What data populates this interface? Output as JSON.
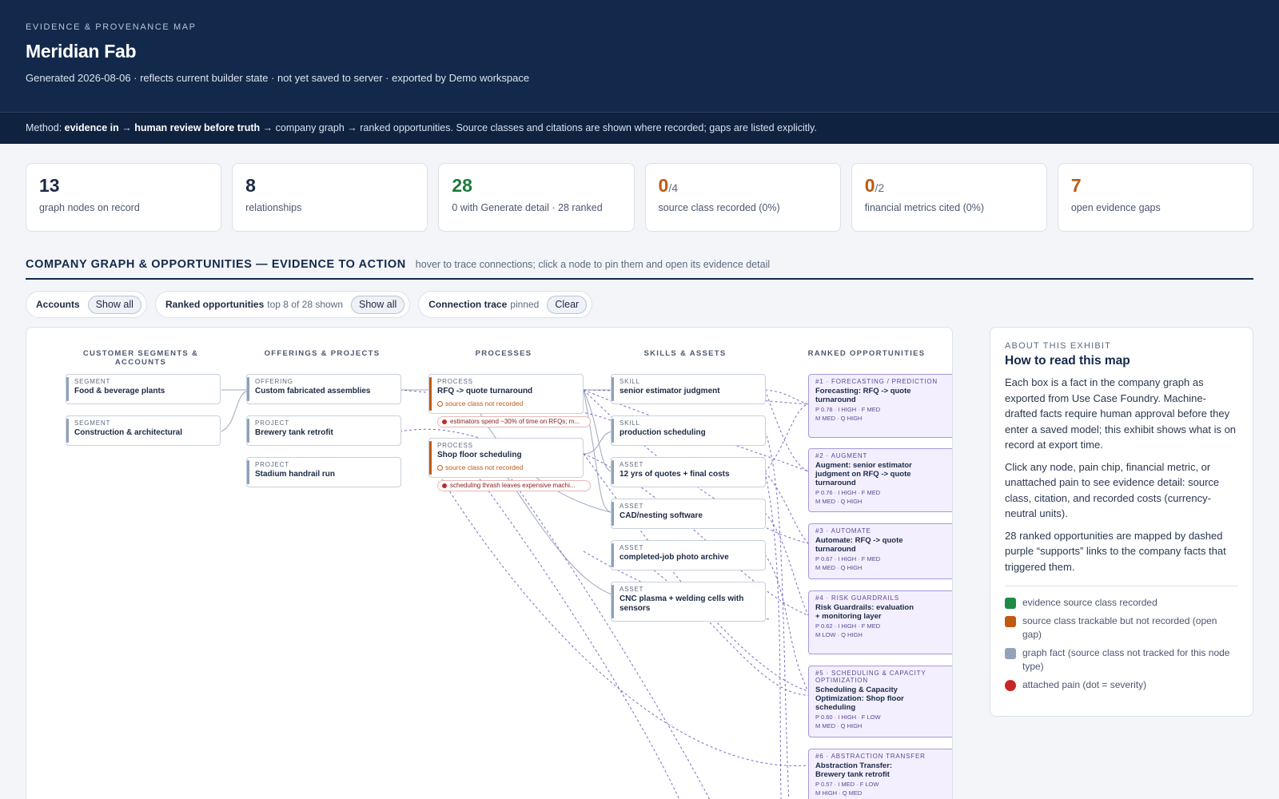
{
  "header": {
    "eyebrow": "EVIDENCE & PROVENANCE MAP",
    "title": "Meridian Fab",
    "subtitle": "Generated 2026-08-06 · reflects current builder state · not yet saved to server · exported by Demo workspace"
  },
  "method": {
    "prefix": "Method: ",
    "bold1": "evidence in",
    "arrow1": " → ",
    "bold2": "human review before truth",
    "rest": " → company graph → ranked opportunities. Source classes and citations are shown where recorded; gaps are listed explicitly."
  },
  "kpis": [
    {
      "value": "13",
      "denominator": "",
      "label": "graph nodes on record",
      "tone": "navy"
    },
    {
      "value": "8",
      "denominator": "",
      "label": "relationships",
      "tone": "navy"
    },
    {
      "value": "28",
      "denominator": "",
      "label": "0 with Generate detail · 28 ranked",
      "tone": "green"
    },
    {
      "value": "0",
      "denominator": "/4",
      "label": "source class recorded (0%)",
      "tone": "orange"
    },
    {
      "value": "0",
      "denominator": "/2",
      "label": "financial metrics cited (0%)",
      "tone": "orange"
    },
    {
      "value": "7",
      "denominator": "",
      "label": "open evidence gaps",
      "tone": "orange"
    }
  ],
  "section": {
    "title": "COMPANY GRAPH & OPPORTUNITIES — EVIDENCE TO ACTION",
    "hint": "hover to trace connections; click a node to pin them and open its evidence detail"
  },
  "controls": {
    "accounts": {
      "label": "Accounts",
      "meta": "",
      "button": "Show all"
    },
    "ranked": {
      "label": "Ranked opportunities",
      "meta": "top 8 of 28 shown",
      "button": "Show all"
    },
    "trace": {
      "label": "Connection trace",
      "meta": "pinned",
      "button": "Clear"
    }
  },
  "graph": {
    "columns": [
      "CUSTOMER SEGMENTS & ACCOUNTS",
      "OFFERINGS & PROJECTS",
      "PROCESSES",
      "SKILLS & ASSETS",
      "RANKED OPPORTUNITIES"
    ],
    "segments": [
      {
        "kind": "SEGMENT",
        "name": "Food & beverage plants"
      },
      {
        "kind": "SEGMENT",
        "name": "Construction & architectural"
      }
    ],
    "offerings": [
      {
        "kind": "OFFERING",
        "name": "Custom fabricated assemblies"
      },
      {
        "kind": "PROJECT",
        "name": "Brewery tank retrofit"
      },
      {
        "kind": "PROJECT",
        "name": "Stadium handrail run"
      }
    ],
    "processes": [
      {
        "kind": "PROCESS",
        "name": "RFQ -> quote turnaround",
        "gap": "source class not recorded",
        "pain": "estimators spend ~30% of time on RFQs; m..."
      },
      {
        "kind": "PROCESS",
        "name": "Shop floor scheduling",
        "gap": "source class not recorded",
        "pain": "scheduling thrash leaves expensive machi..."
      }
    ],
    "skills": [
      {
        "kind": "SKILL",
        "name": "senior estimator judgment"
      },
      {
        "kind": "SKILL",
        "name": "production scheduling"
      },
      {
        "kind": "ASSET",
        "name": "12 yrs of quotes + final costs"
      },
      {
        "kind": "ASSET",
        "name": "CAD/nesting software"
      },
      {
        "kind": "ASSET",
        "name": "completed-job photo archive"
      },
      {
        "kind": "ASSET",
        "name": "CNC plasma + welding cells with sensors"
      }
    ],
    "opportunities": [
      {
        "kind": "#1 · FORECASTING / PREDICTION",
        "name": "Forecasting: RFQ -> quote turnaround",
        "m1": "P 0.78 · I HIGH · F MED",
        "m2": "M MED · Q HIGH"
      },
      {
        "kind": "#2 · AUGMENT",
        "name": "Augment: senior estimator judgment on RFQ -> quote turnaround",
        "m1": "P 0.76 · I HIGH · F MED",
        "m2": "M MED · Q HIGH"
      },
      {
        "kind": "#3 · AUTOMATE",
        "name": "Automate: RFQ -> quote turnaround",
        "m1": "P 0.67 · I HIGH · F MED",
        "m2": "M MED · Q HIGH"
      },
      {
        "kind": "#4 · RISK GUARDRAILS",
        "name": "Risk Guardrails: evaluation + monitoring layer",
        "m1": "P 0.62 · I HIGH · F MED",
        "m2": "M LOW · Q HIGH"
      },
      {
        "kind": "#5 · SCHEDULING & CAPACITY OPTIMIZATION",
        "name": "Scheduling & Capacity Optimization: Shop floor scheduling",
        "m1": "P 0.60 · I HIGH · F LOW",
        "m2": "M MED · Q HIGH"
      },
      {
        "kind": "#6 · ABSTRACTION TRANSFER",
        "name": "Abstraction Transfer: Brewery tank retrofit",
        "m1": "P 0.57 · I MED · F LOW",
        "m2": "M HIGH · Q MED"
      }
    ]
  },
  "about": {
    "eyebrow": "ABOUT THIS EXHIBIT",
    "title": "How to read this map",
    "p1": "Each box is a fact in the company graph as exported from Use Case Foundry. Machine-drafted facts require human approval before they enter a saved model; this exhibit shows what is on record at export time.",
    "p2": "Click any node, pain chip, financial metric, or unattached pain to see evidence detail: source class, citation, and recorded costs (currency-neutral units).",
    "p3": "28 ranked opportunities are mapped by dashed purple “supports” links to the company facts that triggered them.",
    "legend": [
      {
        "label": "evidence source class recorded",
        "color": "#1e8a45"
      },
      {
        "label": "source class trackable but not recorded (open gap)",
        "color": "#c05a12"
      },
      {
        "label": "graph fact (source class not tracked for this node type)",
        "color": "#94a3ba"
      },
      {
        "label": "attached pain (dot = severity)",
        "color": "#c62828"
      }
    ]
  }
}
